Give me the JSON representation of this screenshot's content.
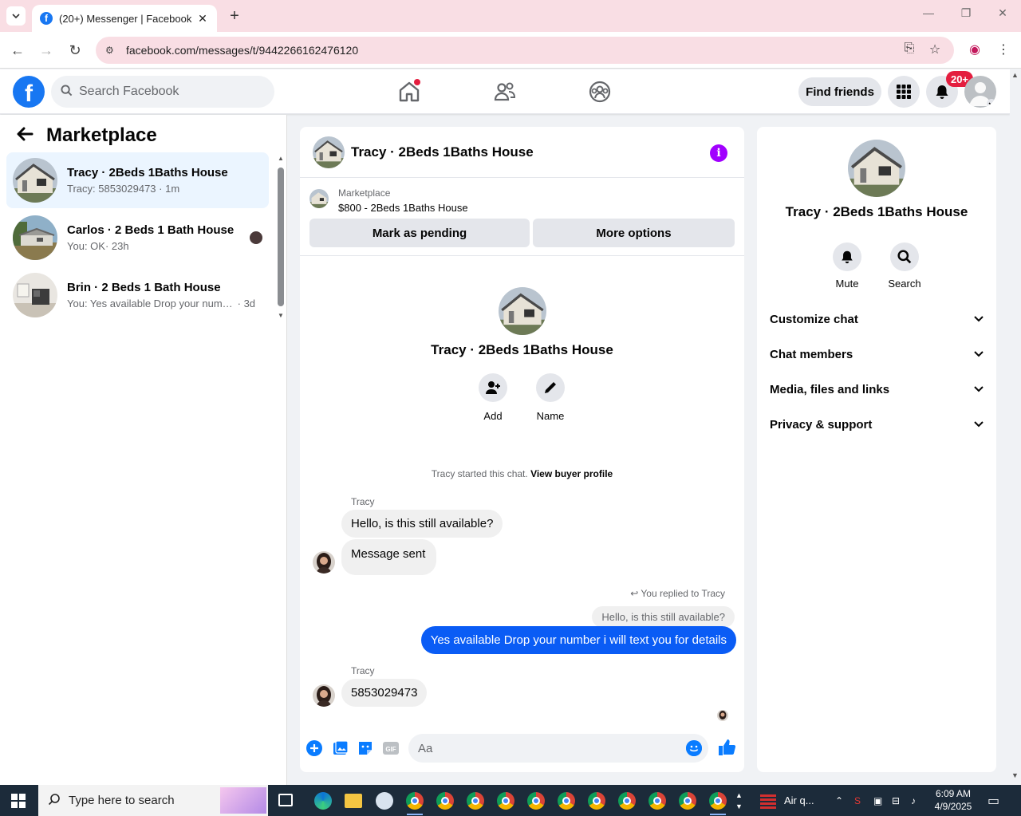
{
  "browser": {
    "tab_title": "(20+) Messenger | Facebook",
    "url": "facebook.com/messages/t/9442266162476120",
    "favicon": "facebook-icon"
  },
  "fb_header": {
    "search_placeholder": "Search Facebook",
    "find_friends": "Find friends",
    "notifications_badge": "20+"
  },
  "left": {
    "title": "Marketplace",
    "conversations": [
      {
        "name": "Tracy · 2Beds 1Baths House",
        "message": "Tracy: 5853029473",
        "time": "· 1m",
        "active": true
      },
      {
        "name": "Carlos · 2 Beds 1 Bath House",
        "message": "You: OK",
        "time": "· 23h",
        "active": false
      },
      {
        "name": "Brin · 2 Beds 1 Bath House",
        "message": "You: Yes available Drop your numb...",
        "time": "· 3d",
        "active": false
      }
    ]
  },
  "chat": {
    "title": "Tracy · 2Beds 1Baths House",
    "listing_source": "Marketplace",
    "listing_title": "$800 - 2Beds 1Baths House",
    "mark_pending": "Mark as pending",
    "more_options": "More options",
    "center_name": "Tracy · 2Beds 1Baths House",
    "add_label": "Add",
    "name_label": "Name",
    "started_text": "Tracy started this chat.",
    "view_profile": "View buyer profile",
    "messages": {
      "sender1": "Tracy",
      "in1": "Hello, is this still available?",
      "in2": "Message sent",
      "replied_to": "You replied to Tracy",
      "quoted": "Hello, is this still available?",
      "out1": "Yes available Drop your number i will text you for details",
      "sender2": "Tracy",
      "in3": "5853029473"
    },
    "composer_placeholder": "Aa"
  },
  "right": {
    "name": "Tracy · 2Beds 1Baths House",
    "mute": "Mute",
    "search": "Search",
    "sections": [
      "Customize chat",
      "Chat members",
      "Media, files and links",
      "Privacy & support"
    ]
  },
  "taskbar": {
    "search_placeholder": "Type here to search",
    "weather": "Air q...",
    "time": "6:09 AM",
    "date": "4/9/2025"
  },
  "colors": {
    "fb_blue": "#1877f2",
    "bubble_out": "#0a5cf5",
    "info_purple": "#a100ff",
    "badge_red": "#e41e3f"
  }
}
